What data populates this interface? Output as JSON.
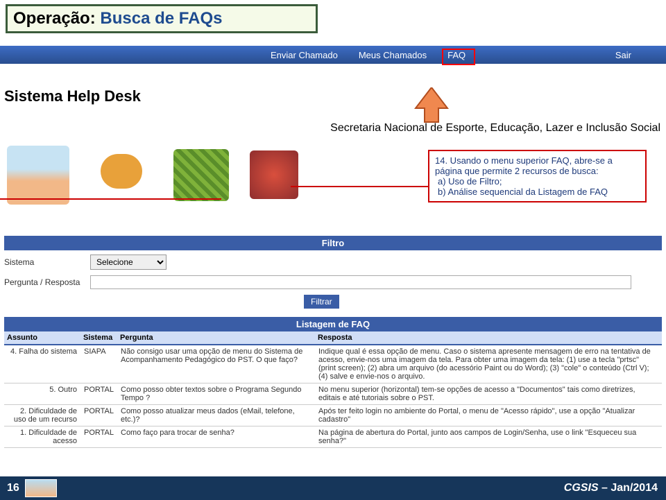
{
  "page_title": {
    "part1": "Operação: ",
    "part2": "Busca de FAQs"
  },
  "topnav": {
    "enviar": "Enviar Chamado",
    "meus": "Meus Chamados",
    "faq": "FAQ",
    "sair": "Sair"
  },
  "sys_title": "Sistema Help Desk",
  "secretaria": "Secretaria Nacional de Esporte, Educação, Lazer e Inclusão Social",
  "callout": {
    "text": "14. Usando o menu superior FAQ, abre-se a página que permite 2 recursos de busca:",
    "a": "a)   Uso de Filtro;",
    "b": "b)   Análise sequencial da Listagem de FAQ"
  },
  "filtro": {
    "title": "Filtro",
    "sistema_label": "Sistema",
    "sistema_value": "Selecione",
    "pergunta_label": "Pergunta / Resposta",
    "filtrar_btn": "Filtrar"
  },
  "listagem_title": "Listagem de FAQ",
  "table": {
    "headers": {
      "assunto": "Assunto",
      "sistema": "Sistema",
      "pergunta": "Pergunta",
      "resposta": "Resposta"
    },
    "rows": [
      {
        "assunto": "4. Falha do sistema",
        "sistema": "SIAPA",
        "pergunta": "Não consigo usar uma opção de menu do Sistema de Acompanhamento Pedagógico do PST. O que faço?",
        "resposta": "Indique qual é essa opção de menu. Caso o sistema apresente mensagem de erro na tentativa de acesso, envie-nos uma imagem da tela.\nPara obter uma imagem da tela: (1) use a tecla \"prtsc\" (print screen); (2) abra um arquivo (do acessório Paint ou do Word); (3) \"cole\" o conteúdo (Ctrl V); (4) salve e envie-nos o arquivo."
      },
      {
        "assunto": "5. Outro",
        "sistema": "PORTAL",
        "pergunta": "Como posso obter textos sobre o Programa Segundo Tempo ?",
        "resposta": "No menu superior (horizontal) tem-se opções de acesso a \"Documentos\" tais como diretrizes, editais e até tutoriais sobre o PST."
      },
      {
        "assunto": "2. Dificuldade de uso de um recurso",
        "sistema": "PORTAL",
        "pergunta": "Como posso atualizar meus dados (eMail, telefone, etc.)?",
        "resposta": "Após ter feito login no ambiente do Portal, o menu de \"Acesso rápido\", use a opção \"Atualizar cadastro\""
      },
      {
        "assunto": "1. Dificuldade de acesso",
        "sistema": "PORTAL",
        "pergunta": "Como faço para trocar de senha?",
        "resposta": "Na página de abertura do Portal, junto aos campos de Login/Senha, use o link \"Esqueceu sua senha?\""
      }
    ]
  },
  "footer": {
    "pageno": "16",
    "right1": "CGSIS",
    "right2": " – Jan/2014"
  }
}
